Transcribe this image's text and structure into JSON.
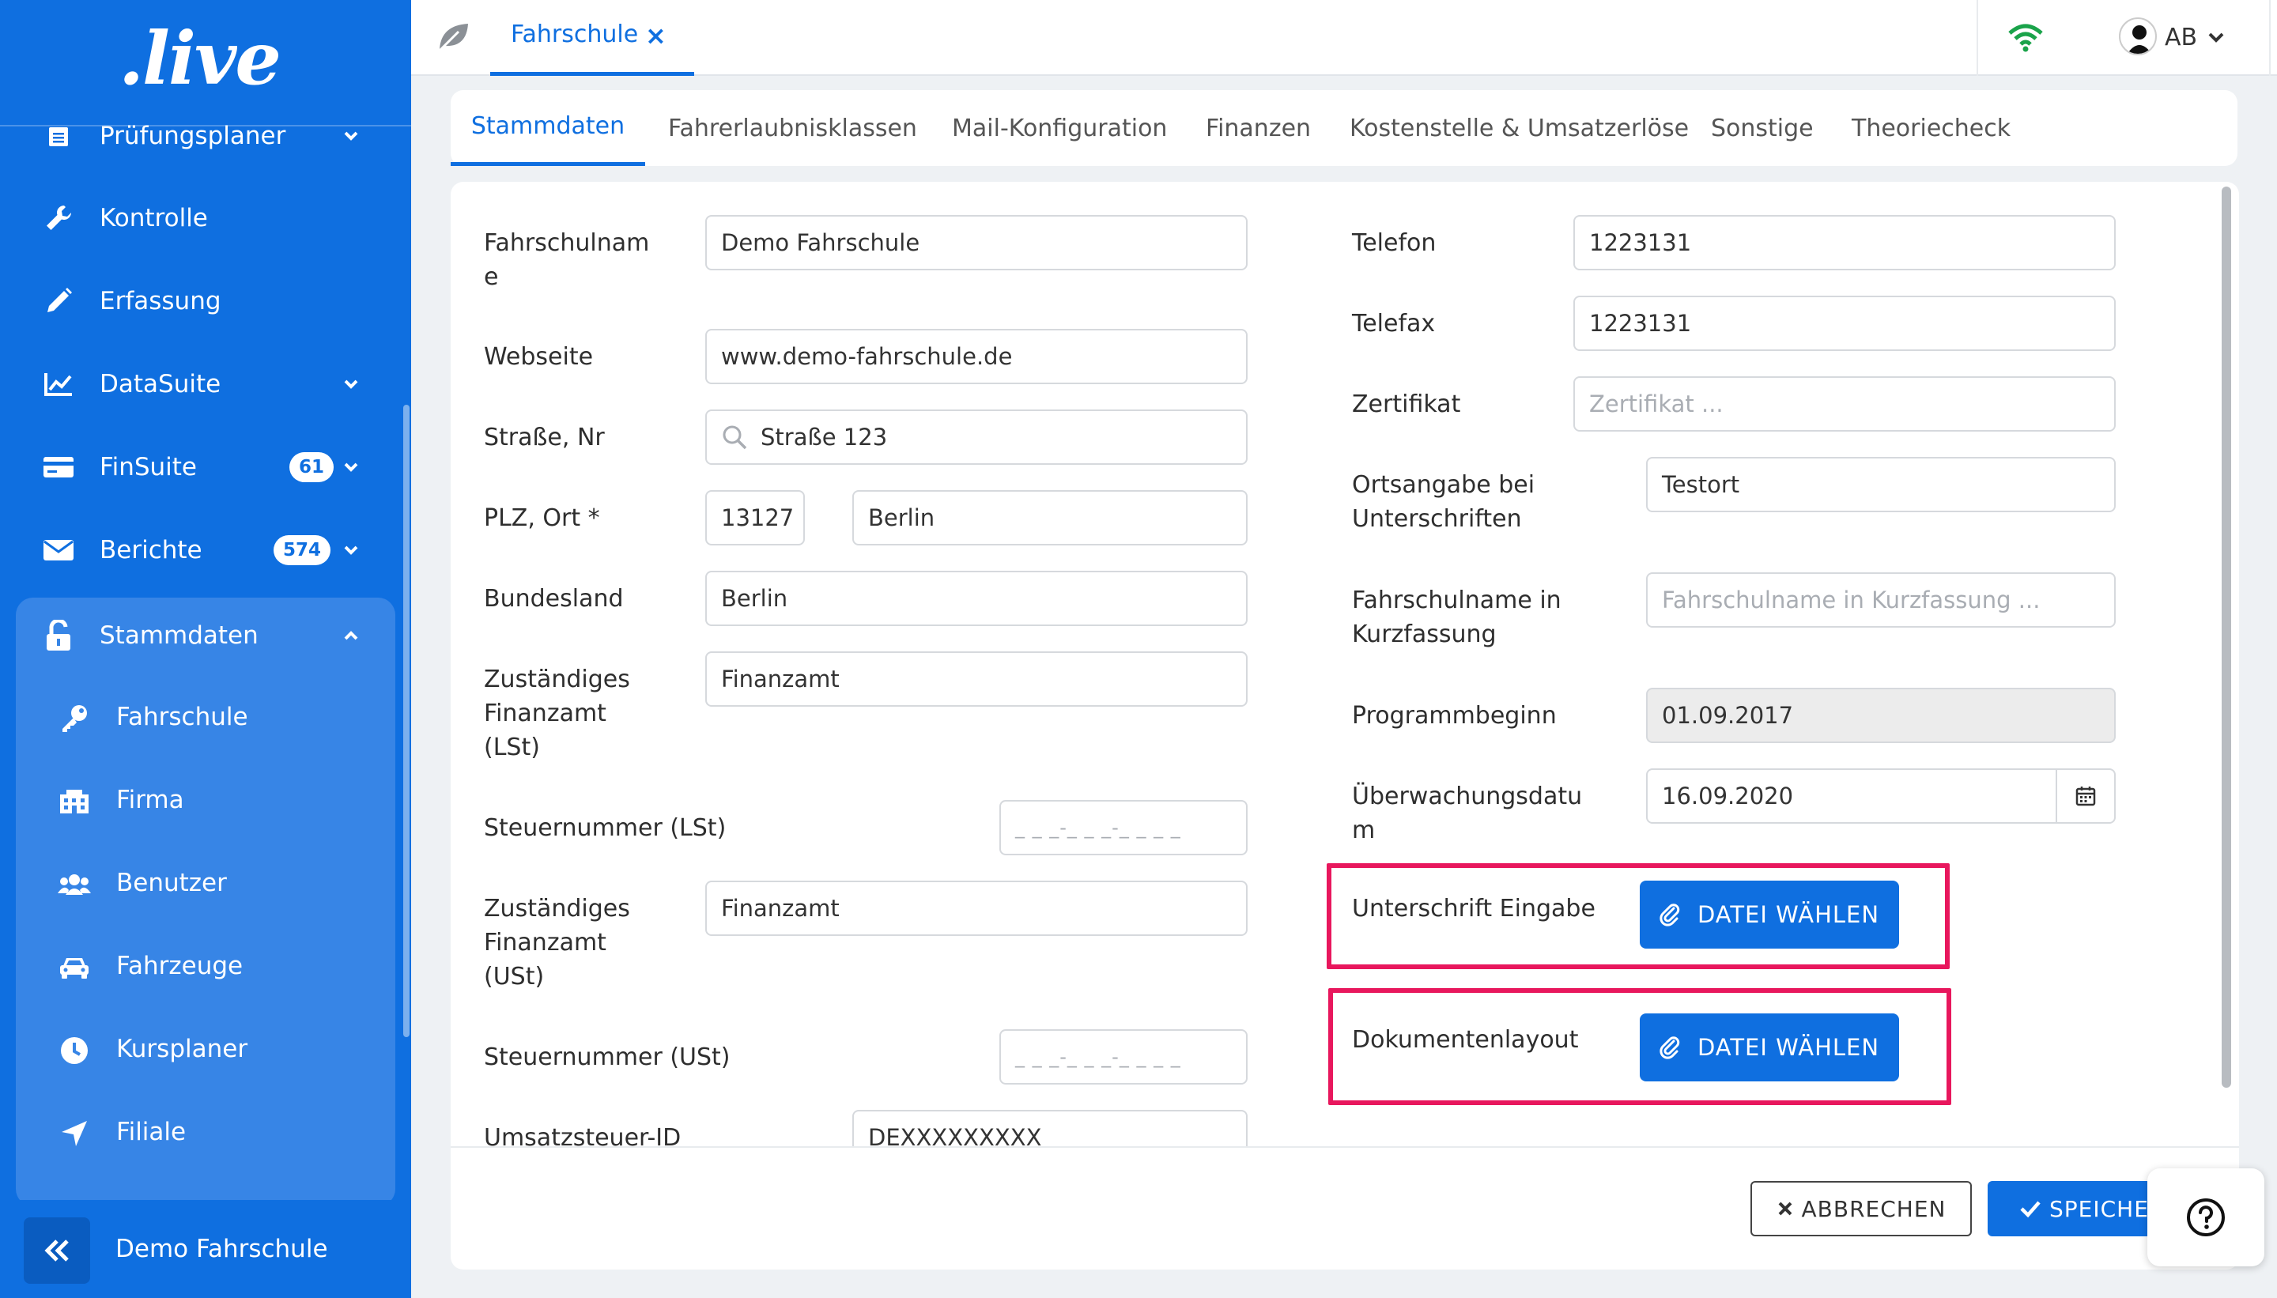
{
  "app": {
    "logo": ".live",
    "accent": "#0f6fe0",
    "highlight": "#e8175d"
  },
  "sidebar": {
    "items": [
      {
        "label": "Prüfungsplaner",
        "icon": "calendar-list-icon",
        "chevron": true
      },
      {
        "label": "Kontrolle",
        "icon": "wrench-icon"
      },
      {
        "label": "Erfassung",
        "icon": "pencil-icon"
      },
      {
        "label": "DataSuite",
        "icon": "chart-line-icon",
        "chevron": true
      },
      {
        "label": "FinSuite",
        "icon": "credit-card-icon",
        "badge": "61",
        "chevron": true
      },
      {
        "label": "Berichte",
        "icon": "envelope-icon",
        "badge": "574",
        "chevron": true
      },
      {
        "label": "Stammdaten",
        "icon": "unlock-icon",
        "chevron_up": true
      }
    ],
    "sub_items": [
      {
        "label": "Fahrschule",
        "icon": "key-icon"
      },
      {
        "label": "Firma",
        "icon": "building-icon"
      },
      {
        "label": "Benutzer",
        "icon": "users-icon"
      },
      {
        "label": "Fahrzeuge",
        "icon": "car-icon"
      },
      {
        "label": "Kursplaner",
        "icon": "clock-icon"
      },
      {
        "label": "Filiale",
        "icon": "location-arrow-icon"
      }
    ],
    "bottom_label": "Demo Fahrschule"
  },
  "topbar": {
    "tab_label": "Fahrschule",
    "tab_close": "×",
    "user_initials": "AB",
    "wifi_color": "#1aa34a"
  },
  "tabs": [
    "Stammdaten",
    "Fahrerlaubnisklassen",
    "Mail-Konfiguration",
    "Finanzen",
    "Kostenstelle & Umsatzerlöse",
    "Sonstige",
    "Theoriecheck"
  ],
  "form": {
    "left": {
      "fahrschulname": {
        "label": "Fahrschulnam\ne",
        "value": "Demo Fahrschule"
      },
      "webseite": {
        "label": "Webseite",
        "value": "www.demo-fahrschule.de"
      },
      "strasse": {
        "label": "Straße, Nr",
        "value": "Straße 123"
      },
      "plz_ort": {
        "label": "PLZ, Ort *",
        "plz": "13127",
        "ort": "Berlin"
      },
      "bundesland": {
        "label": "Bundesland",
        "value": "Berlin"
      },
      "finanzamt_lst": {
        "label": "Zuständiges\nFinanzamt\n(LSt)",
        "value": "Finanzamt"
      },
      "steuernummer_lst": {
        "label": "Steuernummer (LSt)",
        "placeholder": "_ _ _-_ _ _-_ _ _ _"
      },
      "finanzamt_ust": {
        "label": "Zuständiges\nFinanzamt\n(USt)",
        "value": "Finanzamt"
      },
      "steuernummer_ust": {
        "label": "Steuernummer (USt)",
        "placeholder": "_ _ _-_ _ _-_ _ _ _"
      },
      "umsatzsteuer_id": {
        "label": "Umsatzsteuer-ID",
        "value": "DEXXXXXXXXX"
      }
    },
    "right": {
      "telefon": {
        "label": "Telefon",
        "value": "1223131"
      },
      "telefax": {
        "label": "Telefax",
        "value": "1223131"
      },
      "zertifikat": {
        "label": "Zertifikat",
        "placeholder": "Zertifikat ..."
      },
      "ortsangabe": {
        "label": "Ortsangabe bei\nUnterschriften",
        "value": "Testort"
      },
      "kurzname": {
        "label": "Fahrschulname in\nKurzfassung",
        "placeholder": "Fahrschulname in Kurzfassung ..."
      },
      "programmbeginn": {
        "label": "Programmbeginn",
        "value": "01.09.2017"
      },
      "ueberwachung": {
        "label": "Überwachungsdatu\nm",
        "value": "16.09.2020"
      },
      "unterschrift": {
        "label": "Unterschrift Eingabe",
        "button": "DATEI WÄHLEN"
      },
      "dokumentenlayout": {
        "label": "Dokumentenlayout",
        "button": "DATEI WÄHLEN"
      }
    }
  },
  "actions": {
    "cancel": "ABBRECHEN",
    "save": "SPEICHERN"
  }
}
